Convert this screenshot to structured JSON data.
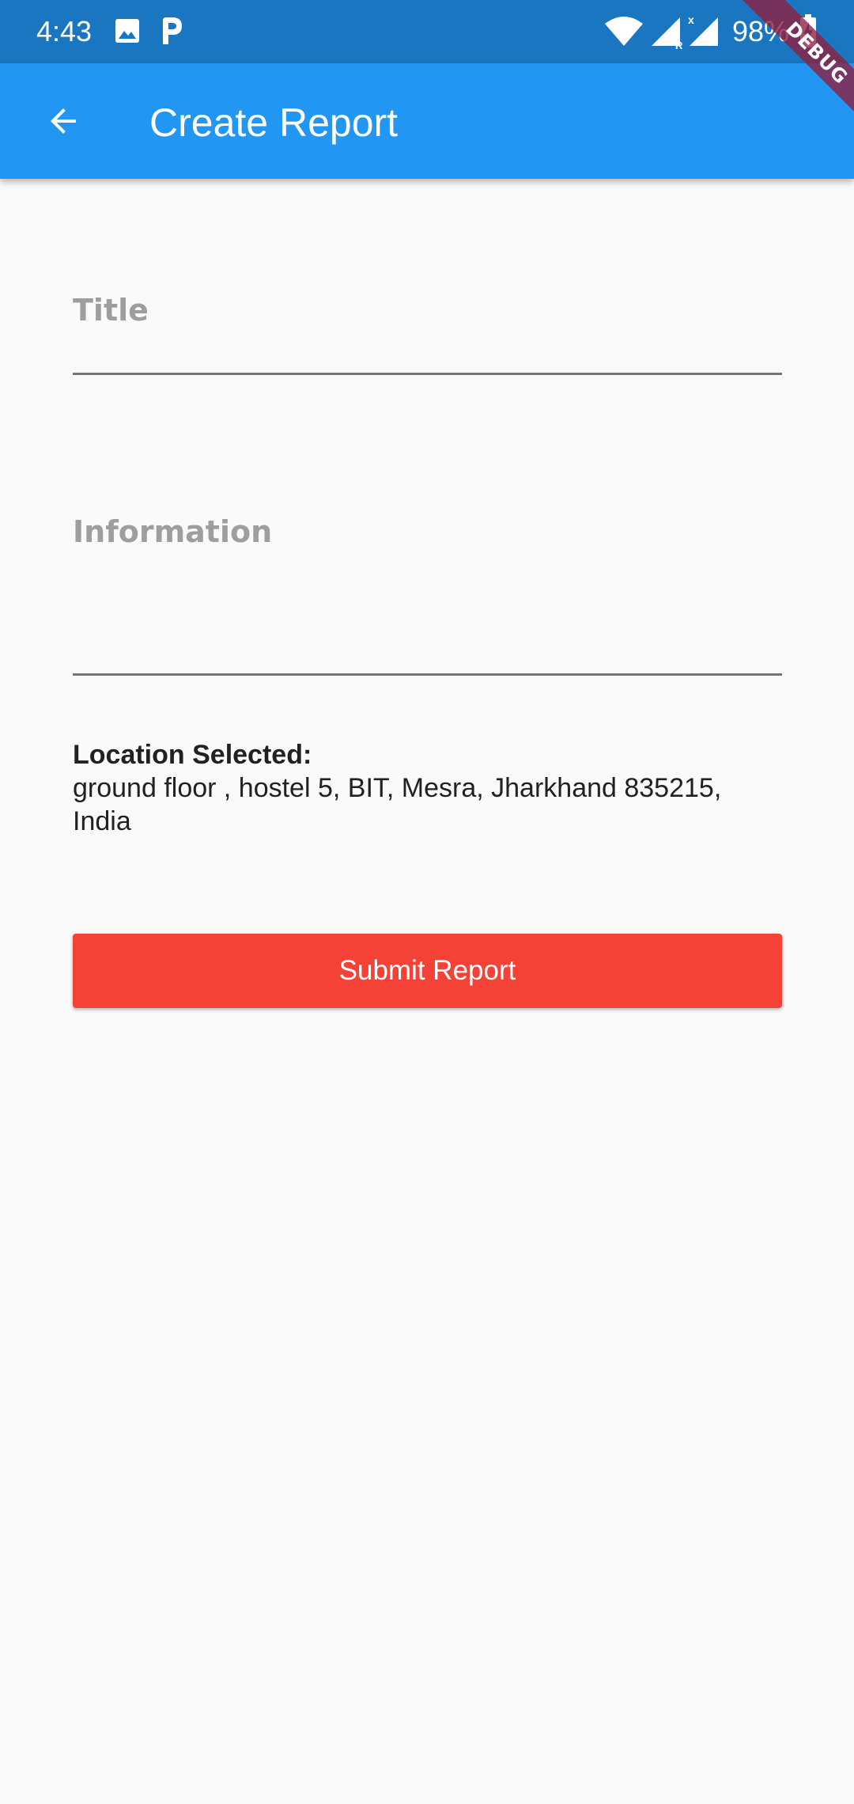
{
  "status_bar": {
    "time": "4:43",
    "battery": "98%",
    "icons": [
      "image-icon",
      "p-icon",
      "wifi-icon",
      "signal-r-icon",
      "signal-x-icon",
      "battery-charging-icon"
    ],
    "background_color": "#1b76c2"
  },
  "app_bar": {
    "title": "Create Report",
    "back_icon": "arrow-back-icon",
    "background_color": "#2196f3"
  },
  "debug_banner": {
    "label": "DEBUG"
  },
  "form": {
    "title_field": {
      "placeholder": "Title",
      "value": ""
    },
    "information_field": {
      "placeholder": "Information",
      "value": ""
    },
    "location": {
      "label": "Location Selected:",
      "value": "ground floor , hostel 5, BIT, Mesra, Jharkhand 835215, India"
    },
    "submit": {
      "label": "Submit Report",
      "color": "#f44336"
    }
  }
}
